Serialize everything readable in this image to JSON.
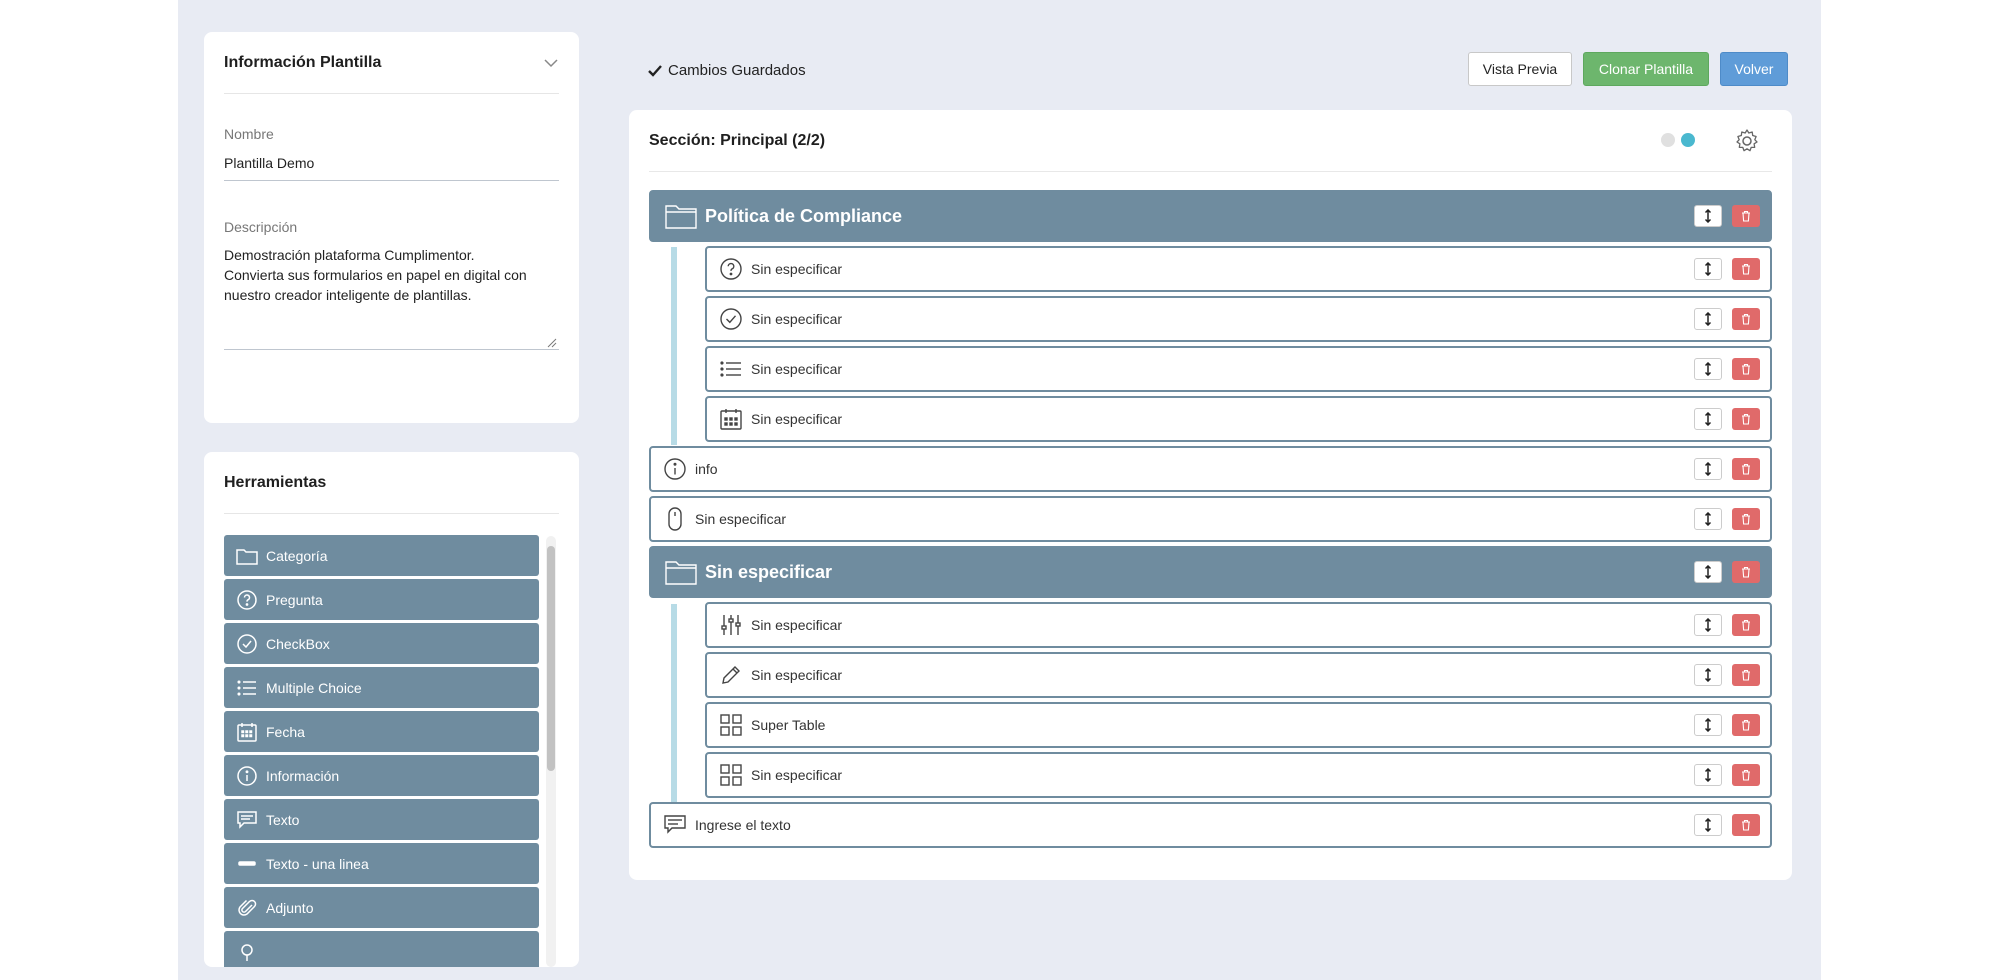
{
  "template_info": {
    "title": "Información Plantilla",
    "name_label": "Nombre",
    "name_value": "Plantilla Demo",
    "description_label": "Descripción",
    "description_lines": [
      "Demostración plataforma Cumplimentor.",
      "Convierta sus formularios en papel en digital con",
      "nuestro creador inteligente de plantillas."
    ]
  },
  "tools": {
    "title": "Herramientas",
    "items": [
      {
        "label": "Categoría",
        "icon": "folder-icon"
      },
      {
        "label": "Pregunta",
        "icon": "question-icon"
      },
      {
        "label": "CheckBox",
        "icon": "check-circle-icon"
      },
      {
        "label": "Multiple Choice",
        "icon": "list-icon"
      },
      {
        "label": "Fecha",
        "icon": "calendar-icon"
      },
      {
        "label": "Información",
        "icon": "info-icon"
      },
      {
        "label": "Texto",
        "icon": "comment-icon"
      },
      {
        "label": "Texto - una linea",
        "icon": "line-icon"
      },
      {
        "label": "Adjunto",
        "icon": "paperclip-icon"
      },
      {
        "label": "",
        "icon": "pin-icon"
      }
    ]
  },
  "toolbar": {
    "saved_status": "Cambios Guardados",
    "preview_label": "Vista Previa",
    "clone_label": "Clonar Plantilla",
    "back_label": "Volver"
  },
  "section": {
    "title": "Sección: Principal (2/2)"
  },
  "rows": [
    {
      "type": "category",
      "label": "Política de Compliance",
      "icon": "folder-icon"
    },
    {
      "type": "child",
      "label": "Sin especificar",
      "icon": "question-icon"
    },
    {
      "type": "child",
      "label": "Sin especificar",
      "icon": "check-circle-icon"
    },
    {
      "type": "child",
      "label": "Sin especificar",
      "icon": "list-icon"
    },
    {
      "type": "child",
      "label": "Sin especificar",
      "icon": "calendar-icon"
    },
    {
      "type": "item",
      "label": "info",
      "icon": "info-icon"
    },
    {
      "type": "item",
      "label": "Sin especificar",
      "icon": "mouse-icon"
    },
    {
      "type": "category",
      "label": "Sin especificar",
      "icon": "folder-icon"
    },
    {
      "type": "child",
      "label": "Sin especificar",
      "icon": "sliders-icon"
    },
    {
      "type": "child",
      "label": "Sin especificar",
      "icon": "pencil-icon"
    },
    {
      "type": "child",
      "label": "Super Table",
      "icon": "grid-icon"
    },
    {
      "type": "child",
      "label": "Sin especificar",
      "icon": "grid-icon"
    },
    {
      "type": "item",
      "label": "Ingrese el texto",
      "icon": "comment-icon"
    }
  ],
  "colors": {
    "category": "#6f8c9f",
    "clone": "#6db66d",
    "back": "#5f9cd8",
    "delete": "#e06a6a",
    "toggle_on": "#4ab8cf"
  }
}
